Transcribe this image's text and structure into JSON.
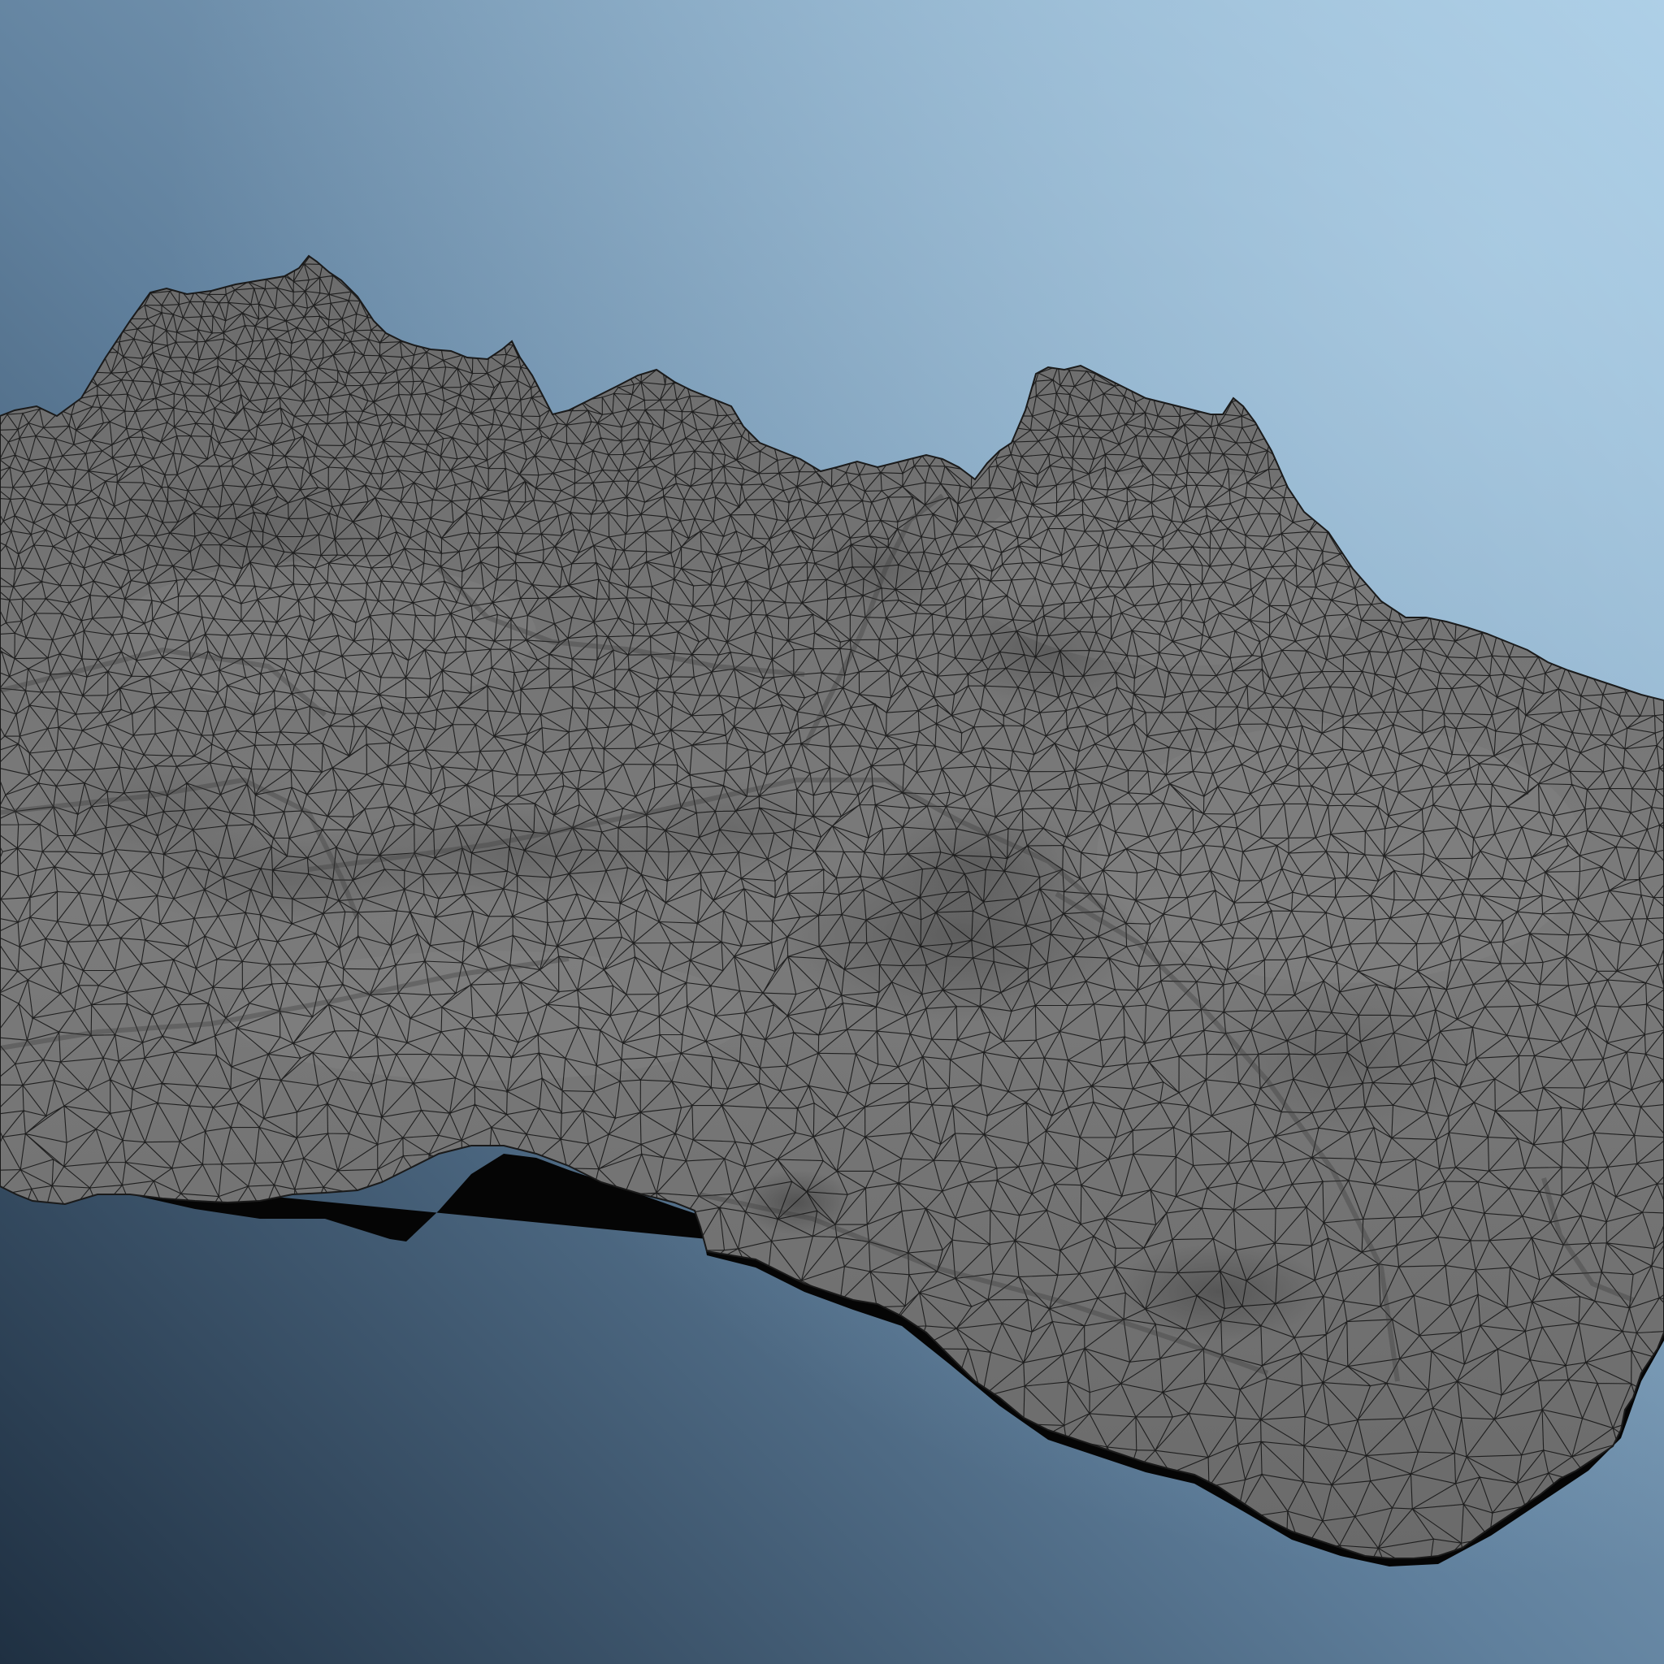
{
  "scene": {
    "subject": "wireframe-terrain-mesh",
    "colors": {
      "background_dark": "#27394c",
      "background_mid": "#6e8fab",
      "background_light": "#a3c6e1",
      "mesh_fill": "#757575",
      "mesh_shadow": "#3a3a3a",
      "mesh_highlight": "#8a8a8a",
      "wire": "#111111",
      "underside": "#0a0a0a"
    }
  }
}
